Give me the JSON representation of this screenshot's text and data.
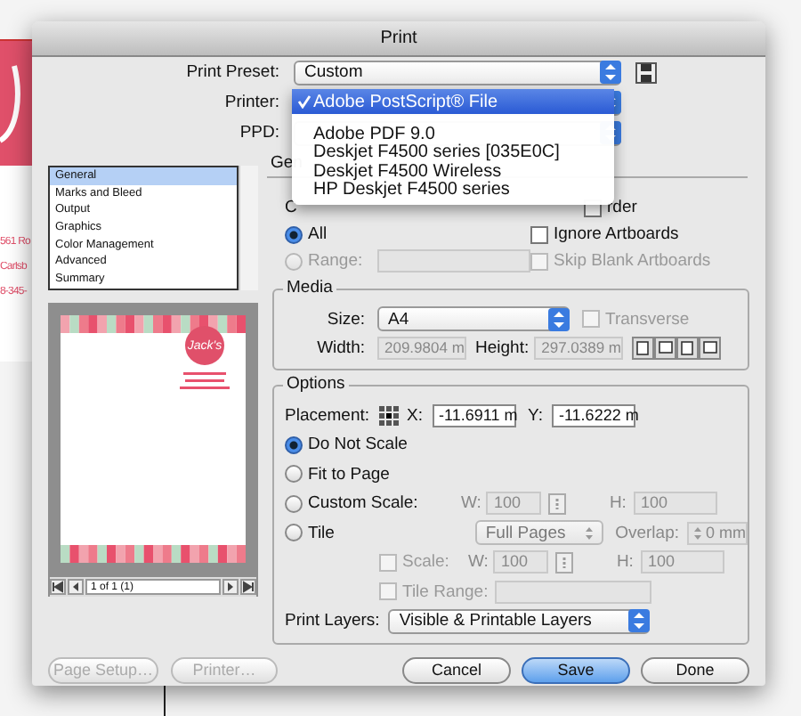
{
  "background_document": {
    "address_lines": [
      "561 Ro",
      "Carlsb",
      "8-345-"
    ]
  },
  "window": {
    "title": "Print"
  },
  "print_preset": {
    "label": "Print Preset:",
    "value": "Custom"
  },
  "printer": {
    "label": "Printer:"
  },
  "ppd": {
    "label": "PPD:"
  },
  "printer_menu": [
    {
      "label": "Adobe PostScript® File",
      "selected": true
    },
    {
      "label": "Adobe PDF 9.0",
      "selected": false
    },
    {
      "label": "Deskjet F4500 series [035E0C]",
      "selected": false
    },
    {
      "label": "Deskjet F4500 Wireless",
      "selected": false
    },
    {
      "label": "HP Deskjet F4500 series",
      "selected": false
    }
  ],
  "categories": [
    {
      "label": "General",
      "selected": true
    },
    {
      "label": "Marks and Bleed",
      "selected": false
    },
    {
      "label": "Output",
      "selected": false
    },
    {
      "label": "Graphics",
      "selected": false
    },
    {
      "label": "Color Management",
      "selected": false
    },
    {
      "label": "Advanced",
      "selected": false
    },
    {
      "label": "Summary",
      "selected": false
    }
  ],
  "preview": {
    "logo_text": "Jack's",
    "page_indicator": "1 of 1 (1)"
  },
  "general": {
    "tab_label": "Gen",
    "pages_label": "C",
    "page_options": [
      {
        "label": "All",
        "selected": true,
        "disabled": false
      },
      {
        "label": "Range:",
        "selected": false,
        "disabled": true
      }
    ],
    "checkboxes": [
      {
        "label": "rder",
        "checked": false,
        "disabled": false
      },
      {
        "label": "Ignore Artboards",
        "checked": false,
        "disabled": false
      },
      {
        "label": "Skip Blank Artboards",
        "checked": false,
        "disabled": true
      }
    ]
  },
  "media": {
    "title": "Media",
    "size_label": "Size:",
    "size": "A4",
    "transverse": {
      "label": "Transverse",
      "checked": false,
      "disabled": true
    },
    "width_label": "Width:",
    "width": "209.9804 m",
    "height_label": "Height:",
    "height": "297.0389 m"
  },
  "options": {
    "title": "Options",
    "placement_label": "Placement:",
    "x_label": "X:",
    "x": "-11.6911 m",
    "y_label": "Y:",
    "y": "-11.6222 m",
    "scale_modes": [
      {
        "label": "Do Not Scale",
        "selected": true
      },
      {
        "label": "Fit to Page",
        "selected": false
      },
      {
        "label": "Custom Scale:",
        "selected": false
      },
      {
        "label": "Tile",
        "selected": false
      }
    ],
    "custom_w_label": "W:",
    "custom_w": "100",
    "custom_h_label": "H:",
    "custom_h": "100",
    "tile_mode": "Full Pages",
    "overlap_label": "Overlap:",
    "overlap": "0 mm",
    "scale_checkbox": {
      "label": "Scale:",
      "checked": false
    },
    "tile_w_label": "W:",
    "tile_w": "100",
    "tile_h_label": "H:",
    "tile_h": "100",
    "tile_range": {
      "label": "Tile Range:",
      "checked": false
    },
    "print_layers_label": "Print Layers:",
    "print_layers": "Visible & Printable Layers"
  },
  "buttons": [
    {
      "label": "Page Setup…",
      "kind": "disabled"
    },
    {
      "label": "Printer…",
      "kind": "disabled"
    },
    {
      "label": "Cancel",
      "kind": "normal"
    },
    {
      "label": "Save",
      "kind": "default"
    },
    {
      "label": "Done",
      "kind": "normal"
    }
  ]
}
